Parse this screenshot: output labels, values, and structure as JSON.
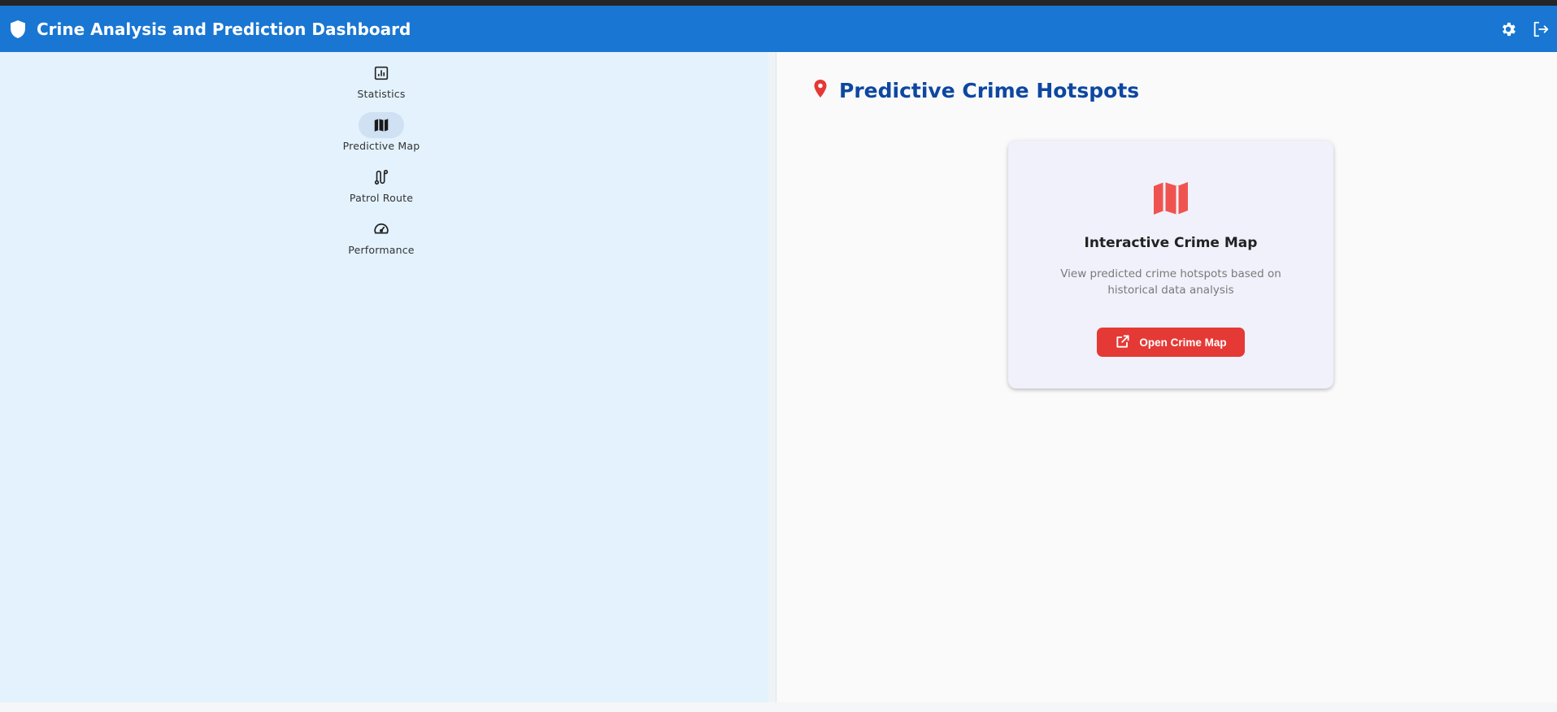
{
  "header": {
    "title": "Crine Analysis and Prediction Dashboard",
    "icons": [
      "shield-icon",
      "settings-icon",
      "logout-icon"
    ]
  },
  "sidebar": {
    "items": [
      {
        "label": "Statistics",
        "icon": "bar-chart-icon",
        "active": false
      },
      {
        "label": "Predictive Map",
        "icon": "map-icon",
        "active": true
      },
      {
        "label": "Patrol Route",
        "icon": "route-icon",
        "active": false
      },
      {
        "label": "Performance",
        "icon": "speedometer-icon",
        "active": false
      }
    ]
  },
  "main": {
    "title": "Predictive Crime Hotspots",
    "title_icon": "location-pin-icon",
    "card": {
      "icon": "map-icon",
      "title": "Interactive Crime Map",
      "description": "View predicted crime hotspots based on historical data analysis",
      "button_label": "Open Crime Map",
      "button_icon": "open-external-icon"
    }
  },
  "colors": {
    "appbar": "#1976d2",
    "sidebar": "#e3f2fd",
    "title": "#0d47a1",
    "accent_red": "#e53935",
    "card_bg": "#f0f1fa"
  }
}
